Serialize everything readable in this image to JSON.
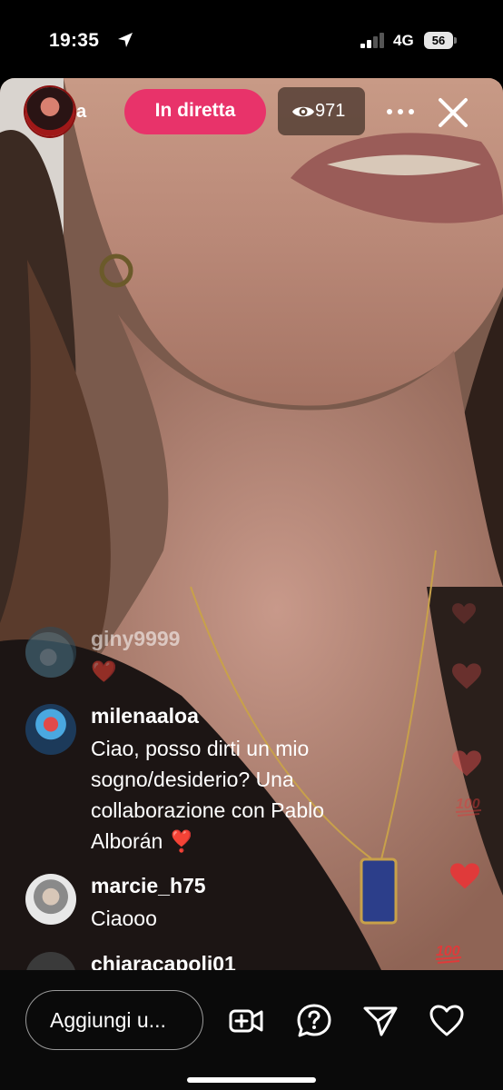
{
  "status_bar": {
    "time": "19:35",
    "network": "4G",
    "battery": "56"
  },
  "live": {
    "host_name_fragment": "a",
    "badge": "In diretta",
    "viewers": "971"
  },
  "comments": [
    {
      "user": "giny9999",
      "text": "❤️"
    },
    {
      "user": "milenaaloa",
      "text": "Ciao, posso dirti un mio sogno/desiderio? Una collaborazione con Pablo Alborán ❣️"
    },
    {
      "user": "marcie_h75",
      "text": "Ciaooo"
    },
    {
      "user": "chiaracapoli01",
      "text": ""
    }
  ],
  "bottom_bar": {
    "comment_placeholder": "Aggiungi u..."
  },
  "icons": [
    "location-arrow-icon",
    "signal-icon",
    "battery-icon",
    "eye-icon",
    "more-icon",
    "close-icon",
    "add-video-icon",
    "question-icon",
    "send-icon",
    "heart-icon"
  ],
  "colors": {
    "live_badge": "#e8336a",
    "background": "#000000"
  }
}
